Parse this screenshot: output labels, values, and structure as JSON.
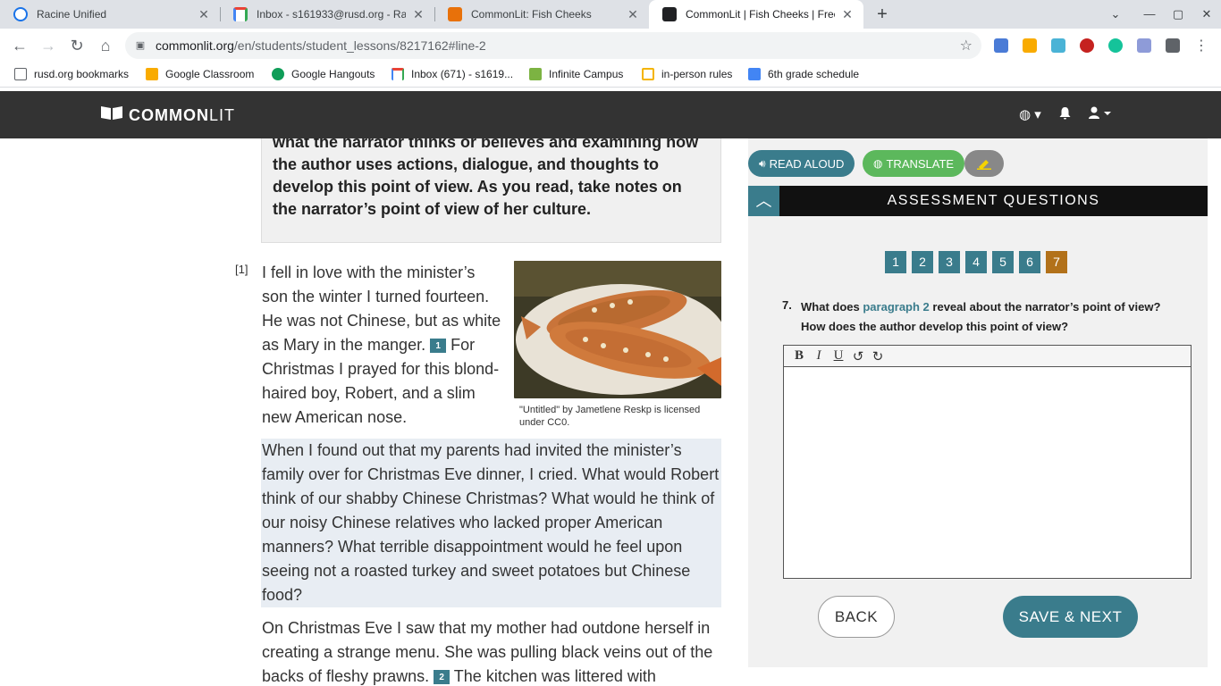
{
  "browser": {
    "tabs": [
      {
        "title": "Racine Unified",
        "active": false,
        "icon": "racine-unified-favicon-icon"
      },
      {
        "title": "Inbox - s161933@rusd.org - Raci",
        "active": false,
        "icon": "gmail-favicon-icon"
      },
      {
        "title": "CommonLit: Fish Cheeks",
        "active": false,
        "icon": "commonlit-orange-favicon-icon"
      },
      {
        "title": "CommonLit | Fish Cheeks | Free",
        "active": true,
        "icon": "commonlit-book-favicon-icon"
      }
    ],
    "url_host": "commonlit.org",
    "url_path": "/en/students/student_lessons/8217162#line-2",
    "bookmarks": [
      {
        "label": "rusd.org bookmarks",
        "icon": "folder-icon"
      },
      {
        "label": "Google Classroom",
        "icon": "google-classroom-icon"
      },
      {
        "label": "Google Hangouts",
        "icon": "google-hangouts-icon"
      },
      {
        "label": "Inbox (671) - s1619...",
        "icon": "gmail-icon"
      },
      {
        "label": "Infinite Campus",
        "icon": "infinite-campus-icon"
      },
      {
        "label": "in-person rules",
        "icon": "slides-icon"
      },
      {
        "label": "6th grade schedule",
        "icon": "docs-icon"
      }
    ]
  },
  "header": {
    "logo_bold": "COMMON",
    "logo_light": "LIT"
  },
  "reading": {
    "intro": "what the narrator thinks or believes and examining how the author uses actions, dialogue, and thoughts to develop this point of view. As you read, take notes on the narrator’s point of view of her culture.",
    "para1_num": "[1]",
    "para1_a": "I fell in love with the minister’s son the winter I turned fourteen. He was not Chinese, but as white as Mary in the manger.",
    "fn1": "1",
    "para1_b": "For Christmas I prayed for this blond-haired boy, Robert, and a slim new American nose.",
    "caption": "\"Untitled\" by Jametlene Reskp is licensed under CC0.",
    "para2": "When I found out that my parents had invited the minister’s family over for Christmas Eve dinner, I cried. What would Robert think of our shabby Chinese Christmas? What would he think of our noisy Chinese relatives who lacked proper American manners? What terrible disappointment would he feel upon seeing not a roasted turkey and sweet potatoes but Chinese food?",
    "para3_a": "On Christmas Eve I saw that my mother had outdone herself in creating a strange menu. She was pulling black veins out of the backs of fleshy prawns.",
    "fn2": "2",
    "para3_b": "The kitchen was littered with appalling"
  },
  "tools": {
    "read_aloud": "READ ALOUD",
    "translate": "TRANSLATE"
  },
  "assessment": {
    "title": "ASSESSMENT QUESTIONS",
    "question_numbers": [
      "1",
      "2",
      "3",
      "4",
      "5",
      "6",
      "7"
    ],
    "current": "7",
    "q_label": "7.",
    "q_pre": "What does",
    "q_link": "paragraph 2",
    "q_post": "reveal about the narrator’s point of view? How does the author develop this point of view?",
    "editor_tools": [
      "B",
      "I",
      "U",
      "↺",
      "↻"
    ],
    "back": "BACK",
    "save_next": "SAVE & NEXT"
  }
}
